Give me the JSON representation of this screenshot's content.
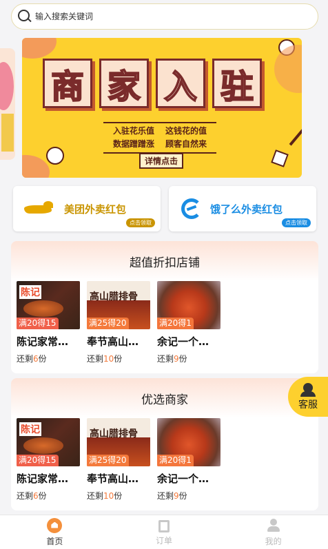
{
  "search": {
    "placeholder": "输入搜索关键词"
  },
  "banner": {
    "title_chars": [
      "商",
      "家",
      "入",
      "驻"
    ],
    "sub_line1": [
      "入驻花乐值",
      "这钱花的值"
    ],
    "sub_line2": [
      "数据蹭蹭涨",
      "顾客自然来"
    ],
    "button": "详情点击"
  },
  "red_packets": [
    {
      "title": "美团外卖红包",
      "tag": "点击领取",
      "icon": "meituan-logo-icon"
    },
    {
      "title": "饿了么外卖红包",
      "tag": "点击领取",
      "icon": "eleme-logo-icon"
    }
  ],
  "sections": [
    {
      "title": "超值折扣店铺",
      "shops": [
        {
          "name": "陈记家常…",
          "badge": "满20得15",
          "remain_prefix": "还剩",
          "remain": "6",
          "remain_suffix": "份"
        },
        {
          "name": "奉节高山…",
          "badge": "满25得20",
          "remain_prefix": "还剩",
          "remain": "10",
          "remain_suffix": "份"
        },
        {
          "name": "余记一个…",
          "badge": "满20得1",
          "remain_prefix": "还剩",
          "remain": "9",
          "remain_suffix": "份"
        }
      ]
    },
    {
      "title": "优选商家",
      "shops": [
        {
          "name": "陈记家常…",
          "badge": "满20得15",
          "remain_prefix": "还剩",
          "remain": "6",
          "remain_suffix": "份"
        },
        {
          "name": "奉节高山…",
          "badge": "满25得20",
          "remain_prefix": "还剩",
          "remain": "10",
          "remain_suffix": "份"
        },
        {
          "name": "余记一个…",
          "badge": "满20得1",
          "remain_prefix": "还剩",
          "remain": "9",
          "remain_suffix": "份"
        }
      ]
    }
  ],
  "shop_image_text": {
    "stamp": "陈记",
    "calligraphy": "高山腊排骨"
  },
  "customer_service": {
    "label": "客服",
    "icon": "headset-icon"
  },
  "tabbar": {
    "items": [
      {
        "label": "首页",
        "icon": "home-icon",
        "active": true
      },
      {
        "label": "订单",
        "icon": "order-icon",
        "active": false
      },
      {
        "label": "我的",
        "icon": "user-icon",
        "active": false
      }
    ]
  },
  "colors": {
    "accent": "#f4903c",
    "banner_bg": "#fdd02e",
    "meituan": "#c99400",
    "eleme": "#1a8de3"
  }
}
